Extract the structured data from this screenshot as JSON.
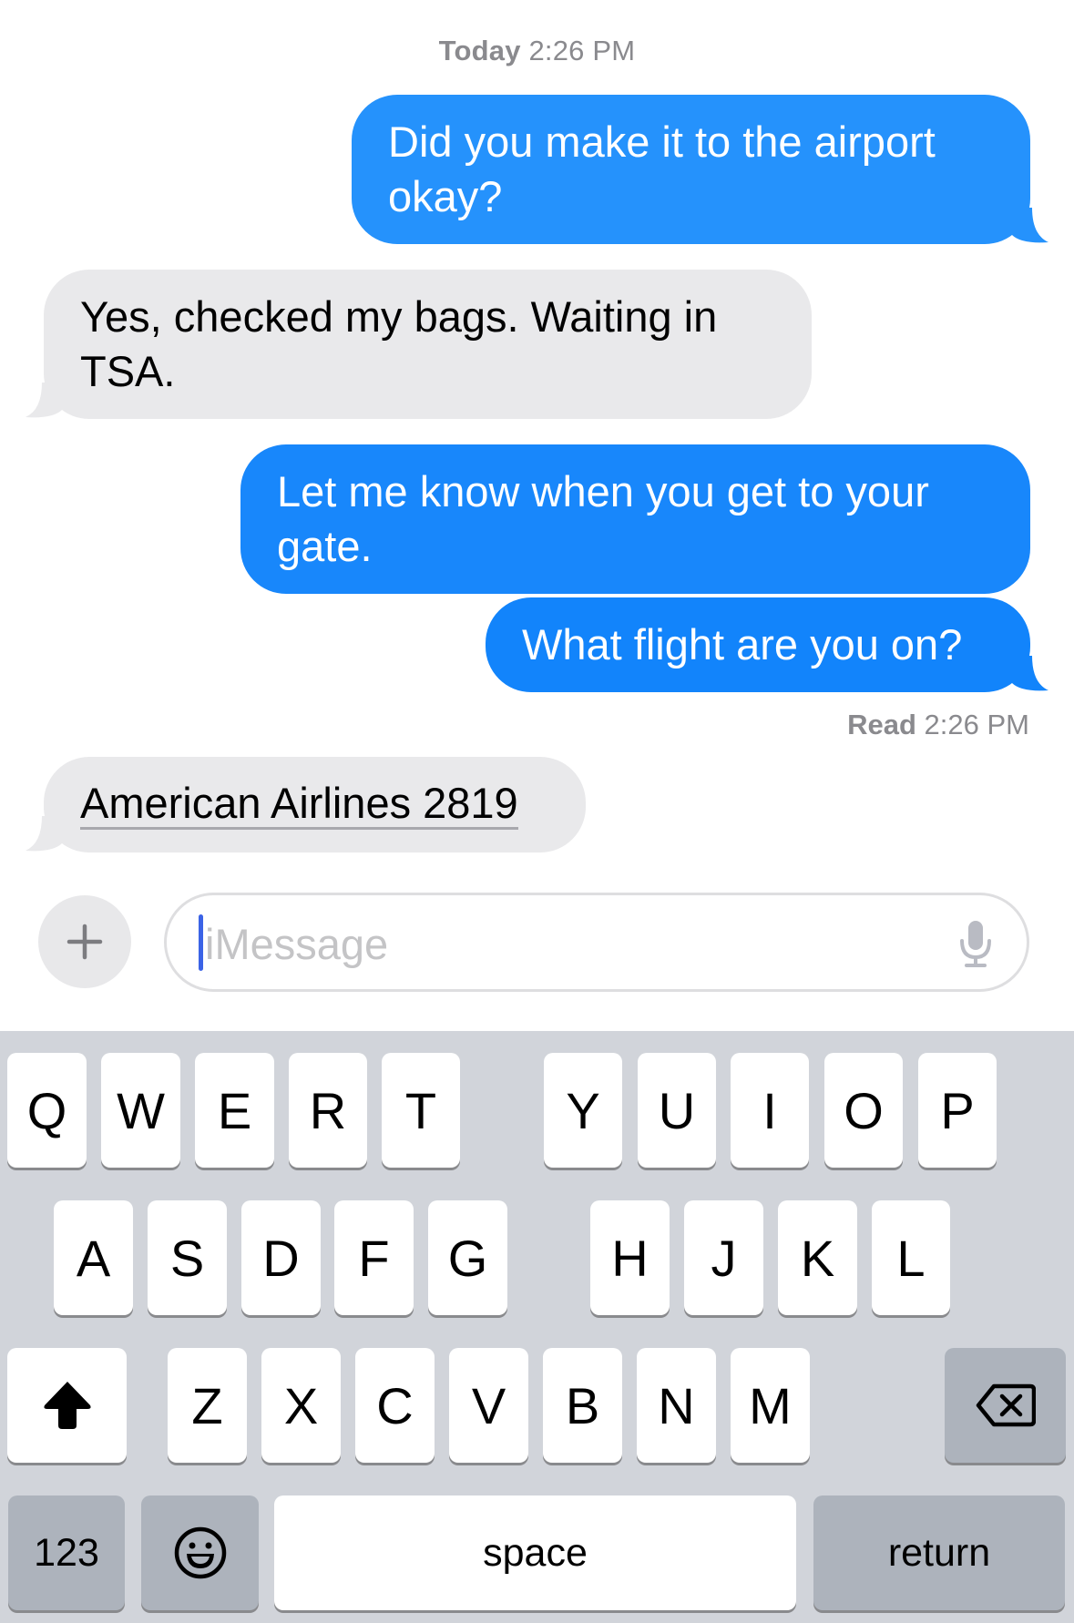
{
  "conversation": {
    "header_timestamp": {
      "day": "Today",
      "time": "2:26 PM"
    },
    "messages": [
      {
        "direction": "sent",
        "text": "Did you make it to the airport okay?"
      },
      {
        "direction": "received",
        "text": "Yes, checked my bags. Waiting in TSA."
      },
      {
        "direction": "sent",
        "text": "Let me know when you get to your gate."
      },
      {
        "direction": "sent",
        "text": "What flight are you on?"
      },
      {
        "direction": "received",
        "text": "American Airlines 2819",
        "is_link": true
      }
    ],
    "read_receipt": {
      "label": "Read",
      "time": "2:26 PM"
    }
  },
  "composer": {
    "add_button_icon": "plus-icon",
    "placeholder": "iMessage",
    "value": "",
    "mic_icon": "microphone-icon"
  },
  "keyboard": {
    "row1": [
      "Q",
      "W",
      "E",
      "R",
      "T",
      "Y",
      "U",
      "I",
      "O",
      "P"
    ],
    "row2": [
      "A",
      "S",
      "D",
      "F",
      "G",
      "H",
      "J",
      "K",
      "L"
    ],
    "row3": [
      "Z",
      "X",
      "C",
      "V",
      "B",
      "N",
      "M"
    ],
    "shift_icon": "shift-arrow-icon",
    "delete_icon": "backspace-icon",
    "numbers_label": "123",
    "emoji_icon": "emoji-face-icon",
    "space_label": "space",
    "return_label": "return"
  },
  "colors": {
    "sent_bubble": "#1f8bfb",
    "received_bubble": "#e9e9eb",
    "caret": "#3b63e6",
    "keyboard_bg": "#d1d4da"
  }
}
